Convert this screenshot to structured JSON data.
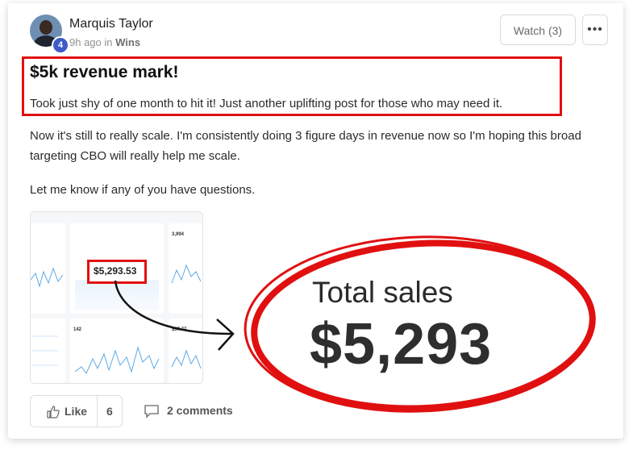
{
  "post": {
    "author": "Marquis Taylor",
    "level": "4",
    "time": "9h ago",
    "in_word": "in",
    "category": "Wins",
    "watch_label": "Watch (3)",
    "more_label": "•••",
    "title": "$5k revenue mark!",
    "lead": "Took just shy of one month to hit it! Just another uplifting post for those who may need it.",
    "paragraphs": [
      "Now it's still to really scale. I'm consistently doing 3 figure days in revenue now so I'm hoping this broad targeting CBO will really help me scale.",
      "Let me know if any of you have questions."
    ]
  },
  "dashboard": {
    "sales_value": "$5,293.53",
    "tile_values": [
      "3,994",
      "142",
      "$37.77"
    ]
  },
  "callout": {
    "label": "Total sales",
    "value": "$5,293"
  },
  "footer": {
    "like_label": "Like",
    "like_count": "6",
    "comments_label": "2 comments"
  },
  "colors": {
    "highlight": "#e11010",
    "chart_line": "#5aa9e6"
  }
}
